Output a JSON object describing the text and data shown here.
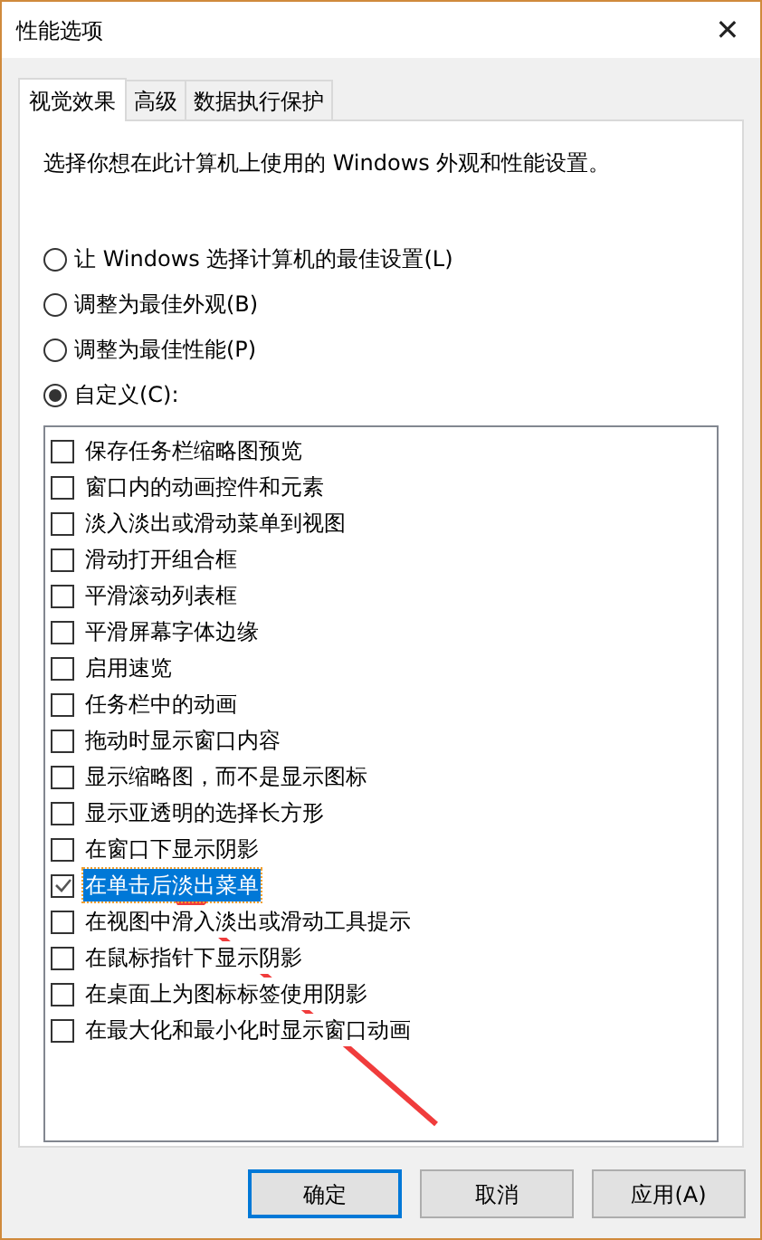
{
  "window": {
    "title": "性能选项",
    "close": "✕"
  },
  "tabs": [
    {
      "label": "视觉效果",
      "selected": true
    },
    {
      "label": "高级",
      "selected": false
    },
    {
      "label": "数据执行保护",
      "selected": false
    }
  ],
  "description": "选择你想在此计算机上使用的 Windows 外观和性能设置。",
  "options": [
    {
      "label": "让 Windows 选择计算机的最佳设置(L)",
      "selected": false
    },
    {
      "label": "调整为最佳外观(B)",
      "selected": false
    },
    {
      "label": "调整为最佳性能(P)",
      "selected": false
    },
    {
      "label": "自定义(C):",
      "selected": true
    }
  ],
  "effects": [
    {
      "label": "保存任务栏缩略图预览",
      "checked": false,
      "selected": false
    },
    {
      "label": "窗口内的动画控件和元素",
      "checked": false,
      "selected": false
    },
    {
      "label": "淡入淡出或滑动菜单到视图",
      "checked": false,
      "selected": false
    },
    {
      "label": "滑动打开组合框",
      "checked": false,
      "selected": false
    },
    {
      "label": "平滑滚动列表框",
      "checked": false,
      "selected": false
    },
    {
      "label": "平滑屏幕字体边缘",
      "checked": false,
      "selected": false
    },
    {
      "label": "启用速览",
      "checked": false,
      "selected": false
    },
    {
      "label": "任务栏中的动画",
      "checked": false,
      "selected": false
    },
    {
      "label": "拖动时显示窗口内容",
      "checked": false,
      "selected": false
    },
    {
      "label": "显示缩略图，而不是显示图标",
      "checked": false,
      "selected": false
    },
    {
      "label": "显示亚透明的选择长方形",
      "checked": false,
      "selected": false
    },
    {
      "label": "在窗口下显示阴影",
      "checked": false,
      "selected": false
    },
    {
      "label": "在单击后淡出菜单",
      "checked": true,
      "selected": true
    },
    {
      "label": "在视图中滑入淡出或滑动工具提示",
      "checked": false,
      "selected": false
    },
    {
      "label": "在鼠标指针下显示阴影",
      "checked": false,
      "selected": false
    },
    {
      "label": "在桌面上为图标标签使用阴影",
      "checked": false,
      "selected": false
    },
    {
      "label": "在最大化和最小化时显示窗口动画",
      "checked": false,
      "selected": false
    }
  ],
  "buttons": [
    {
      "label": "确定",
      "default": true
    },
    {
      "label": "取消",
      "default": false
    },
    {
      "label": "应用(A)",
      "default": false
    }
  ]
}
